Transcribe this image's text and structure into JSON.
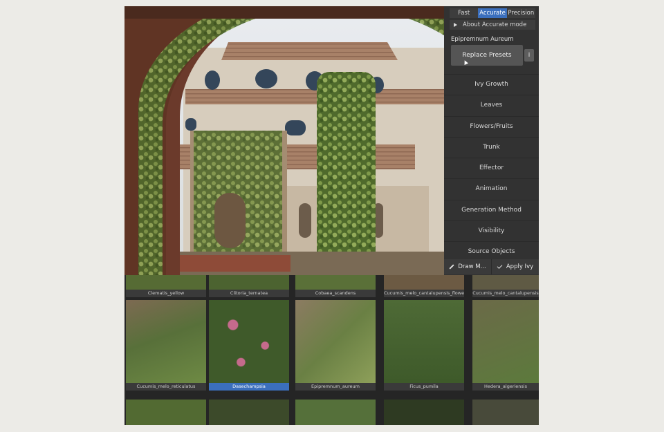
{
  "modes": [
    {
      "label": "Fast",
      "active": false
    },
    {
      "label": "Accurate",
      "active": true
    },
    {
      "label": "Precision",
      "active": false
    }
  ],
  "about_label": "About Accurate mode",
  "preset_name": "Epipremnum Aureum",
  "replace_presets_label": "Replace Presets",
  "info_icon": "i",
  "sections": [
    "Ivy Growth",
    "Leaves",
    "Flowers/Fruits",
    "Trunk",
    "Effector",
    "Animation",
    "Generation Method",
    "Visibility",
    "Source Objects"
  ],
  "footer": {
    "draw_label": "Draw M...",
    "apply_label": "Apply Ivy"
  },
  "colors": {
    "accent": "#3b6fbd",
    "panel": "#323232"
  },
  "thumbnails_top": [
    "Clematis_yellow",
    "Clitoria_ternatea",
    "Cobaea_scandens",
    "Cucumis_melo_cantalupensis_flower",
    "Cucumis_melo_cantalupensis"
  ],
  "thumbnails_mid": [
    {
      "label": "Cucumis_melo_reticulatus",
      "selected": false
    },
    {
      "label": "Dasechampsia",
      "selected": true
    },
    {
      "label": "Epipremnum_aureum",
      "selected": false
    },
    {
      "label": "Ficus_pumila",
      "selected": false
    },
    {
      "label": "Hedera_algeriensis",
      "selected": false
    }
  ]
}
